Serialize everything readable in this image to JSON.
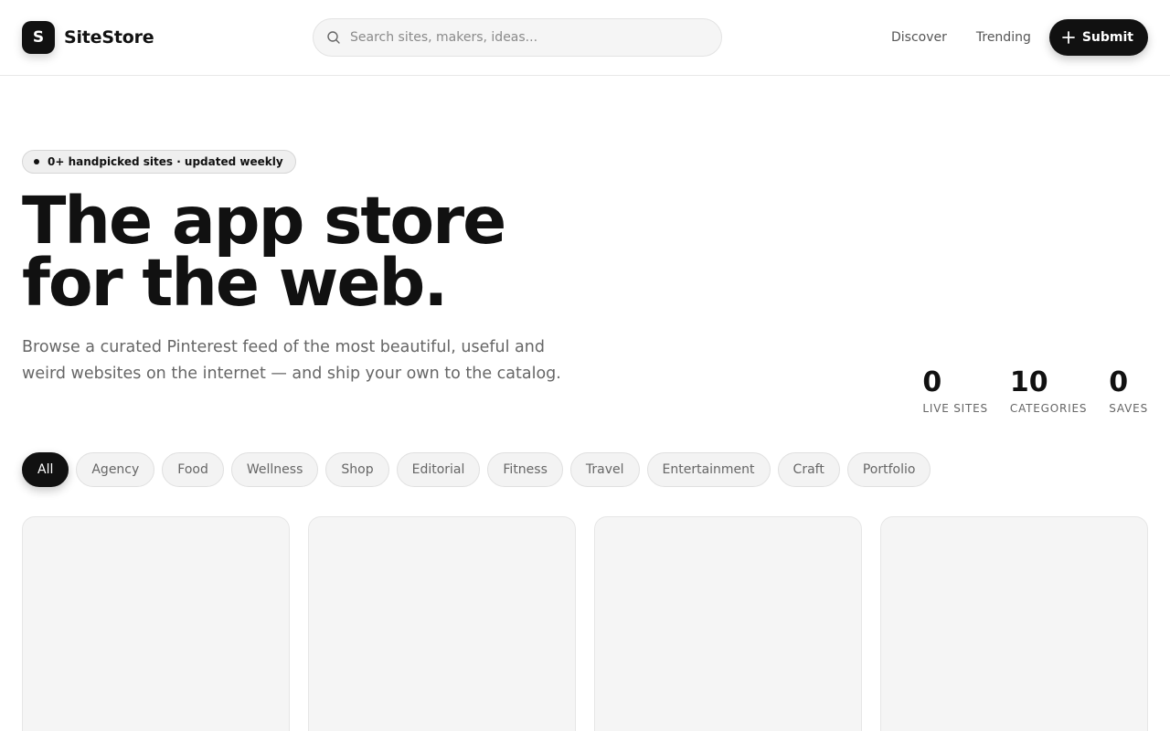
{
  "brand": {
    "logo_letter": "S",
    "name": "SiteStore"
  },
  "search": {
    "placeholder": "Search sites, makers, ideas..."
  },
  "nav": {
    "links": [
      "Discover",
      "Trending"
    ],
    "submit_label": "Submit"
  },
  "hero": {
    "badge": "0+ handpicked sites · updated weekly",
    "title_line_1": "The app store",
    "title_line_2": "for the web.",
    "subtitle": "Browse a curated Pinterest feed of the most beautiful, useful and weird websites on the internet — and ship your own to the catalog."
  },
  "stats": [
    {
      "value": "0",
      "label": "LIVE SITES"
    },
    {
      "value": "10",
      "label": "CATEGORIES"
    },
    {
      "value": "0",
      "label": "SAVES"
    }
  ],
  "categories": {
    "selected": "All",
    "items": [
      "All",
      "Agency",
      "Food",
      "Wellness",
      "Shop",
      "Editorial",
      "Fitness",
      "Travel",
      "Entertainment",
      "Craft",
      "Portfolio"
    ]
  },
  "colors": {
    "accent": "#111111",
    "muted_text": "#666666",
    "chip_bg": "#f3f3f3"
  },
  "icons": {
    "search": "search-icon",
    "submit": "plus-icon"
  }
}
